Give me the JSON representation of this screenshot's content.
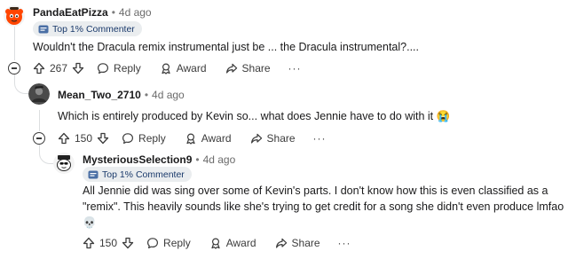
{
  "comments": [
    {
      "username": "PandaEatPizza",
      "separator": "•",
      "time": "4d ago",
      "badge": "Top 1% Commenter",
      "body": "Wouldn't the Dracula remix instrumental just be ... the Dracula instrumental?....",
      "votes": "267",
      "reply": "Reply",
      "award": "Award",
      "share": "Share",
      "more": "···"
    },
    {
      "username": "Mean_Two_2710",
      "separator": "•",
      "time": "4d ago",
      "body": "Which is entirely produced by Kevin so... what does Jennie have to do with it 😭",
      "votes": "150",
      "reply": "Reply",
      "award": "Award",
      "share": "Share",
      "more": "···"
    },
    {
      "username": "MysteriousSelection9",
      "separator": "•",
      "time": "4d ago",
      "badge": "Top 1% Commenter",
      "body_line1": "All Jennie did was sing over some of Kevin's parts. I don't know how this is even classified as a",
      "body_line2": "\"remix\". This heavily sounds like she's trying to get credit for a song she didn't even produce lmfao",
      "body_line3": "💀",
      "votes": "150",
      "reply": "Reply",
      "award": "Award",
      "share": "Share",
      "more": "···"
    }
  ],
  "icons": {
    "upvote": "upvote-icon",
    "downvote": "downvote-icon",
    "reply": "speech-bubble-icon",
    "award": "award-icon",
    "share": "share-arrow-icon",
    "collapse": "collapse-minus-icon",
    "badge": "commenter-badge-icon"
  },
  "colors": {
    "badge_bg": "#eaedef",
    "badge_text": "#1a3a6b",
    "text": "#1a1a1b",
    "meta": "#6b6b6b",
    "thread_line": "#dcdee0"
  }
}
